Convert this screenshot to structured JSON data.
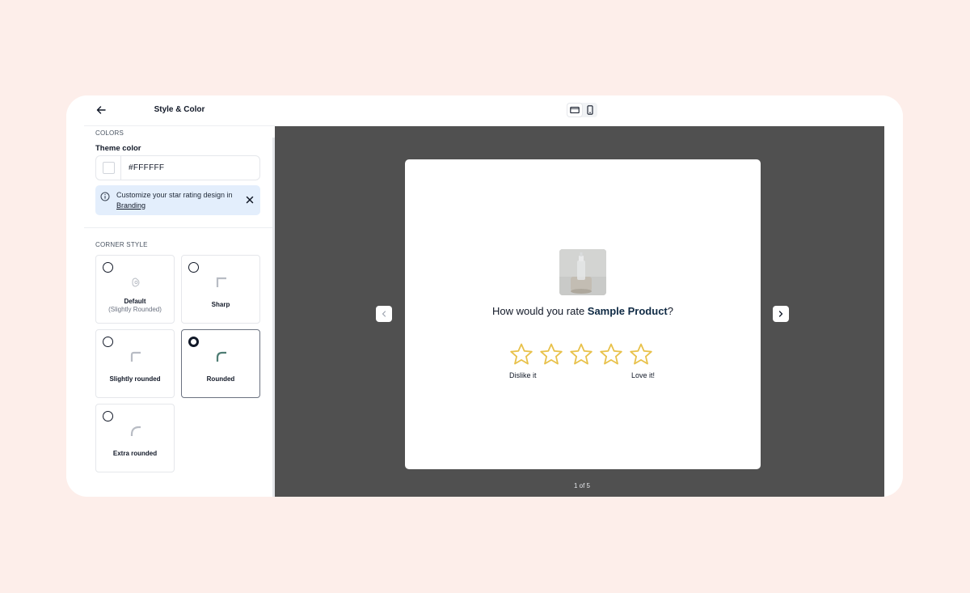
{
  "sidebar": {
    "title": "Style & Color",
    "colors_section": "COLORS",
    "theme_color_label": "Theme color",
    "theme_color_value": "#FFFFFF",
    "info": {
      "text": "Customize your star rating design in ",
      "link": "Branding"
    },
    "corner_section": "CORNER STYLE",
    "corner_options": [
      {
        "label": "Default",
        "sub": "(Slightly Rounded)",
        "selected": false
      },
      {
        "label": "Sharp",
        "selected": false
      },
      {
        "label": "Slightly rounded",
        "selected": false
      },
      {
        "label": "Rounded",
        "selected": true
      },
      {
        "label": "Extra rounded",
        "selected": false
      }
    ]
  },
  "preview": {
    "question_prefix": "How would you rate ",
    "product_name": "Sample Product",
    "question_suffix": "?",
    "rating_scale": 5,
    "low_label": "Dislike it",
    "high_label": "Love it!",
    "page_indicator": "1 of 5"
  },
  "colors": {
    "background": "#fdeeea",
    "preview_bg": "#505050",
    "star": "#e8c14a",
    "accent": "#4f7d74"
  },
  "icons": {
    "back": "arrow-left-icon",
    "info": "info-icon",
    "close": "close-icon",
    "desktop": "desktop-icon",
    "mobile": "mobile-icon",
    "prev": "chevron-left-icon",
    "next": "chevron-right-icon",
    "star": "star-outline-icon"
  }
}
